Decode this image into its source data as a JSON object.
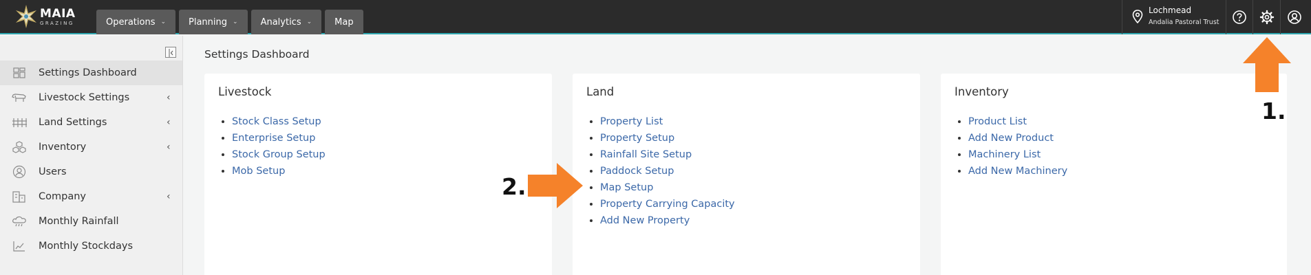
{
  "app": {
    "brand": "MAIA",
    "brand_sub": "GRAZING"
  },
  "nav": [
    {
      "label": "Operations",
      "has_menu": true
    },
    {
      "label": "Planning",
      "has_menu": true
    },
    {
      "label": "Analytics",
      "has_menu": true
    },
    {
      "label": "Map",
      "has_menu": false
    }
  ],
  "user": {
    "property": "Lochmead",
    "organisation": "Andalia Pastoral Trust"
  },
  "top_icons": [
    "help-icon",
    "settings-icon",
    "account-icon"
  ],
  "sidebar": {
    "items": [
      {
        "label": "Settings Dashboard",
        "icon": "dashboard-icon",
        "active": true,
        "expandable": false
      },
      {
        "label": "Livestock Settings",
        "icon": "cow-icon",
        "active": false,
        "expandable": true
      },
      {
        "label": "Land Settings",
        "icon": "fence-icon",
        "active": false,
        "expandable": true
      },
      {
        "label": "Inventory",
        "icon": "boxes-icon",
        "active": false,
        "expandable": true
      },
      {
        "label": "Users",
        "icon": "user-icon",
        "active": false,
        "expandable": false
      },
      {
        "label": "Company",
        "icon": "building-icon",
        "active": false,
        "expandable": true
      },
      {
        "label": "Monthly Rainfall",
        "icon": "rain-icon",
        "active": false,
        "expandable": false
      },
      {
        "label": "Monthly Stockdays",
        "icon": "chart-icon",
        "active": false,
        "expandable": false
      }
    ]
  },
  "main": {
    "title": "Settings Dashboard",
    "cards": [
      {
        "title": "Livestock",
        "links": [
          "Stock Class Setup",
          "Enterprise Setup",
          "Stock Group Setup",
          "Mob Setup"
        ]
      },
      {
        "title": "Land",
        "links": [
          "Property List",
          "Property Setup",
          "Rainfall Site Setup",
          "Paddock Setup",
          "Map Setup",
          "Property Carrying Capacity",
          "Add New Property"
        ]
      },
      {
        "title": "Inventory",
        "links": [
          "Product List",
          "Add New Product",
          "Machinery List",
          "Add New Machinery"
        ]
      }
    ]
  },
  "annotations": {
    "step1": "1.",
    "step2": "2.",
    "arrow_color": "#f5822a"
  }
}
